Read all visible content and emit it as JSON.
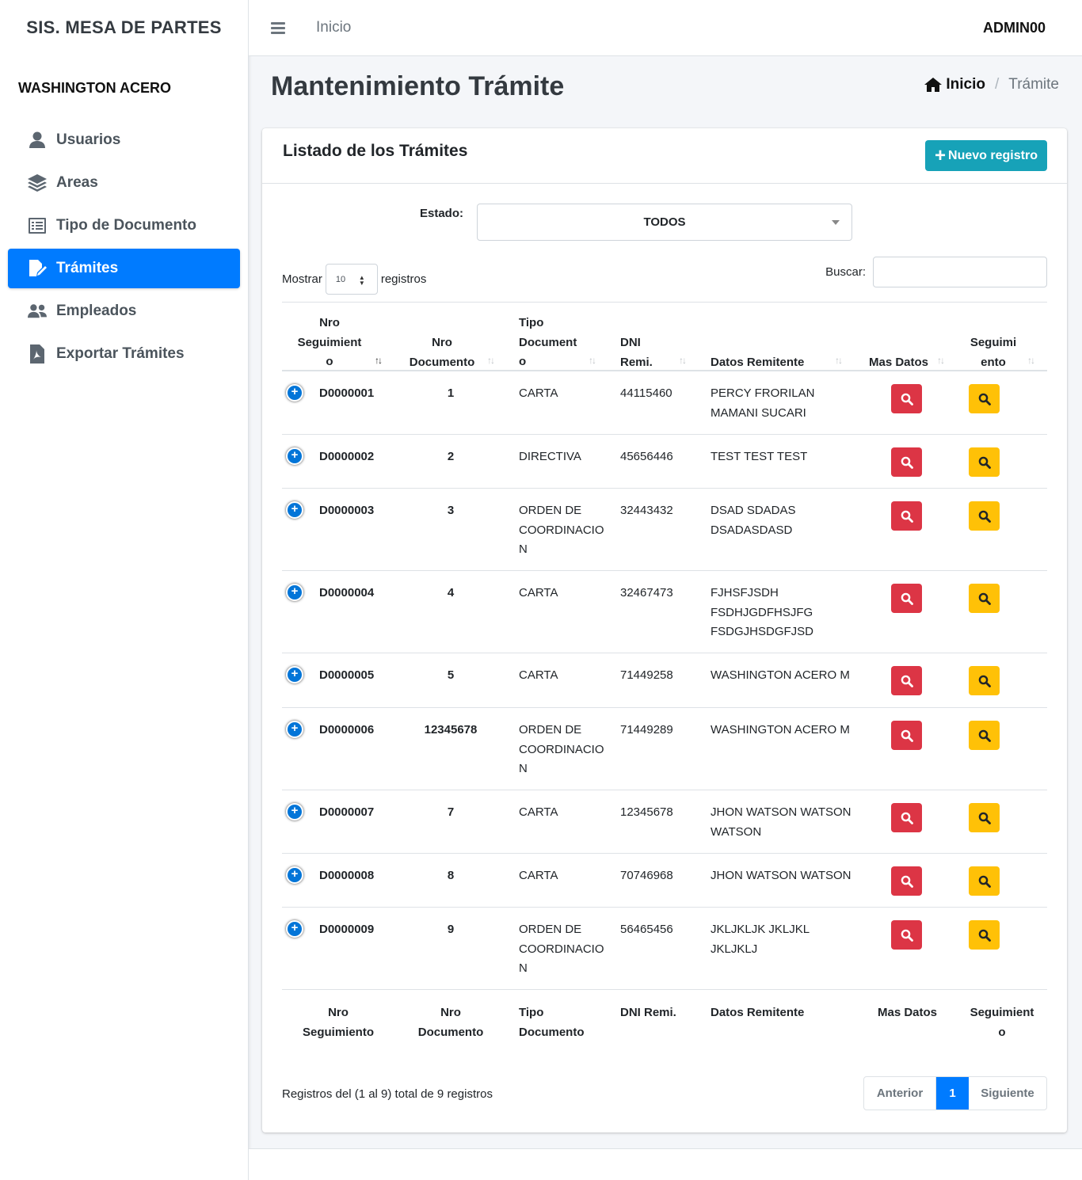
{
  "sidebar": {
    "brand": "SIS. MESA DE PARTES",
    "user": "WASHINGTON ACERO",
    "items": [
      {
        "label": "Usuarios",
        "icon": "user-icon"
      },
      {
        "label": "Areas",
        "icon": "layers-icon"
      },
      {
        "label": "Tipo de Documento",
        "icon": "list-icon"
      },
      {
        "label": "Trámites",
        "icon": "edit-file-icon",
        "active": true
      },
      {
        "label": "Empleados",
        "icon": "users-icon"
      },
      {
        "label": "Exportar Trámites",
        "icon": "pdf-file-icon"
      }
    ]
  },
  "topbar": {
    "home_link": "Inicio",
    "user": "ADMIN00"
  },
  "header": {
    "title": "Mantenimiento Trámite",
    "breadcrumb_home": "Inicio",
    "breadcrumb_sep": "/",
    "breadcrumb_current": "Trámite"
  },
  "card": {
    "title": "Listado de los Trámites",
    "new_button": "Nuevo registro",
    "estado_label": "Estado:",
    "estado_value": "TODOS",
    "show_prefix": "Mostrar",
    "show_value": "10",
    "show_suffix": "registros",
    "search_label": "Buscar:",
    "search_value": ""
  },
  "table": {
    "headers": {
      "seguimiento": "Nro Seguimiento",
      "documento": "Nro Documento",
      "tipo": "Tipo Documento",
      "dni": "DNI Remi.",
      "datos": "Datos Remitente",
      "mas": "Mas Datos",
      "segui": "Seguimiento"
    },
    "rows": [
      {
        "seg": "D0000001",
        "doc": "1",
        "tipo": "CARTA",
        "dni": "44115460",
        "datos": "PERCY FRORILAN MAMANI SUCARI"
      },
      {
        "seg": "D0000002",
        "doc": "2",
        "tipo": "DIRECTIVA",
        "dni": "45656446",
        "datos": "TEST TEST TEST"
      },
      {
        "seg": "D0000003",
        "doc": "3",
        "tipo": "ORDEN DE COORDINACION",
        "dni": "32443432",
        "datos": "DSAD SDADAS DSADASDASD"
      },
      {
        "seg": "D0000004",
        "doc": "4",
        "tipo": "CARTA",
        "dni": "32467473",
        "datos": "FJHSFJSDH FSDHJGDFHSJFG FSDGJHSDGFJSD"
      },
      {
        "seg": "D0000005",
        "doc": "5",
        "tipo": "CARTA",
        "dni": "71449258",
        "datos": "WASHINGTON ACERO M"
      },
      {
        "seg": "D0000006",
        "doc": "12345678",
        "tipo": "ORDEN DE COORDINACION",
        "dni": "71449289",
        "datos": "WASHINGTON ACERO M"
      },
      {
        "seg": "D0000007",
        "doc": "7",
        "tipo": "CARTA",
        "dni": "12345678",
        "datos": "JHON WATSON WATSON WATSON"
      },
      {
        "seg": "D0000008",
        "doc": "8",
        "tipo": "CARTA",
        "dni": "70746968",
        "datos": "JHON WATSON WATSON"
      },
      {
        "seg": "D0000009",
        "doc": "9",
        "tipo": "ORDEN DE COORDINACION",
        "dni": "56465456",
        "datos": "JKLJKLJK JKLJKL JKLJKLJ"
      }
    ]
  },
  "footer": {
    "info": "Registros del (1 al 9) total de 9 registros",
    "prev": "Anterior",
    "page": "1",
    "next": "Siguiente"
  },
  "colors": {
    "primary": "#007bff",
    "info": "#17a2b8",
    "danger": "#dc3545",
    "warning": "#ffc107"
  }
}
